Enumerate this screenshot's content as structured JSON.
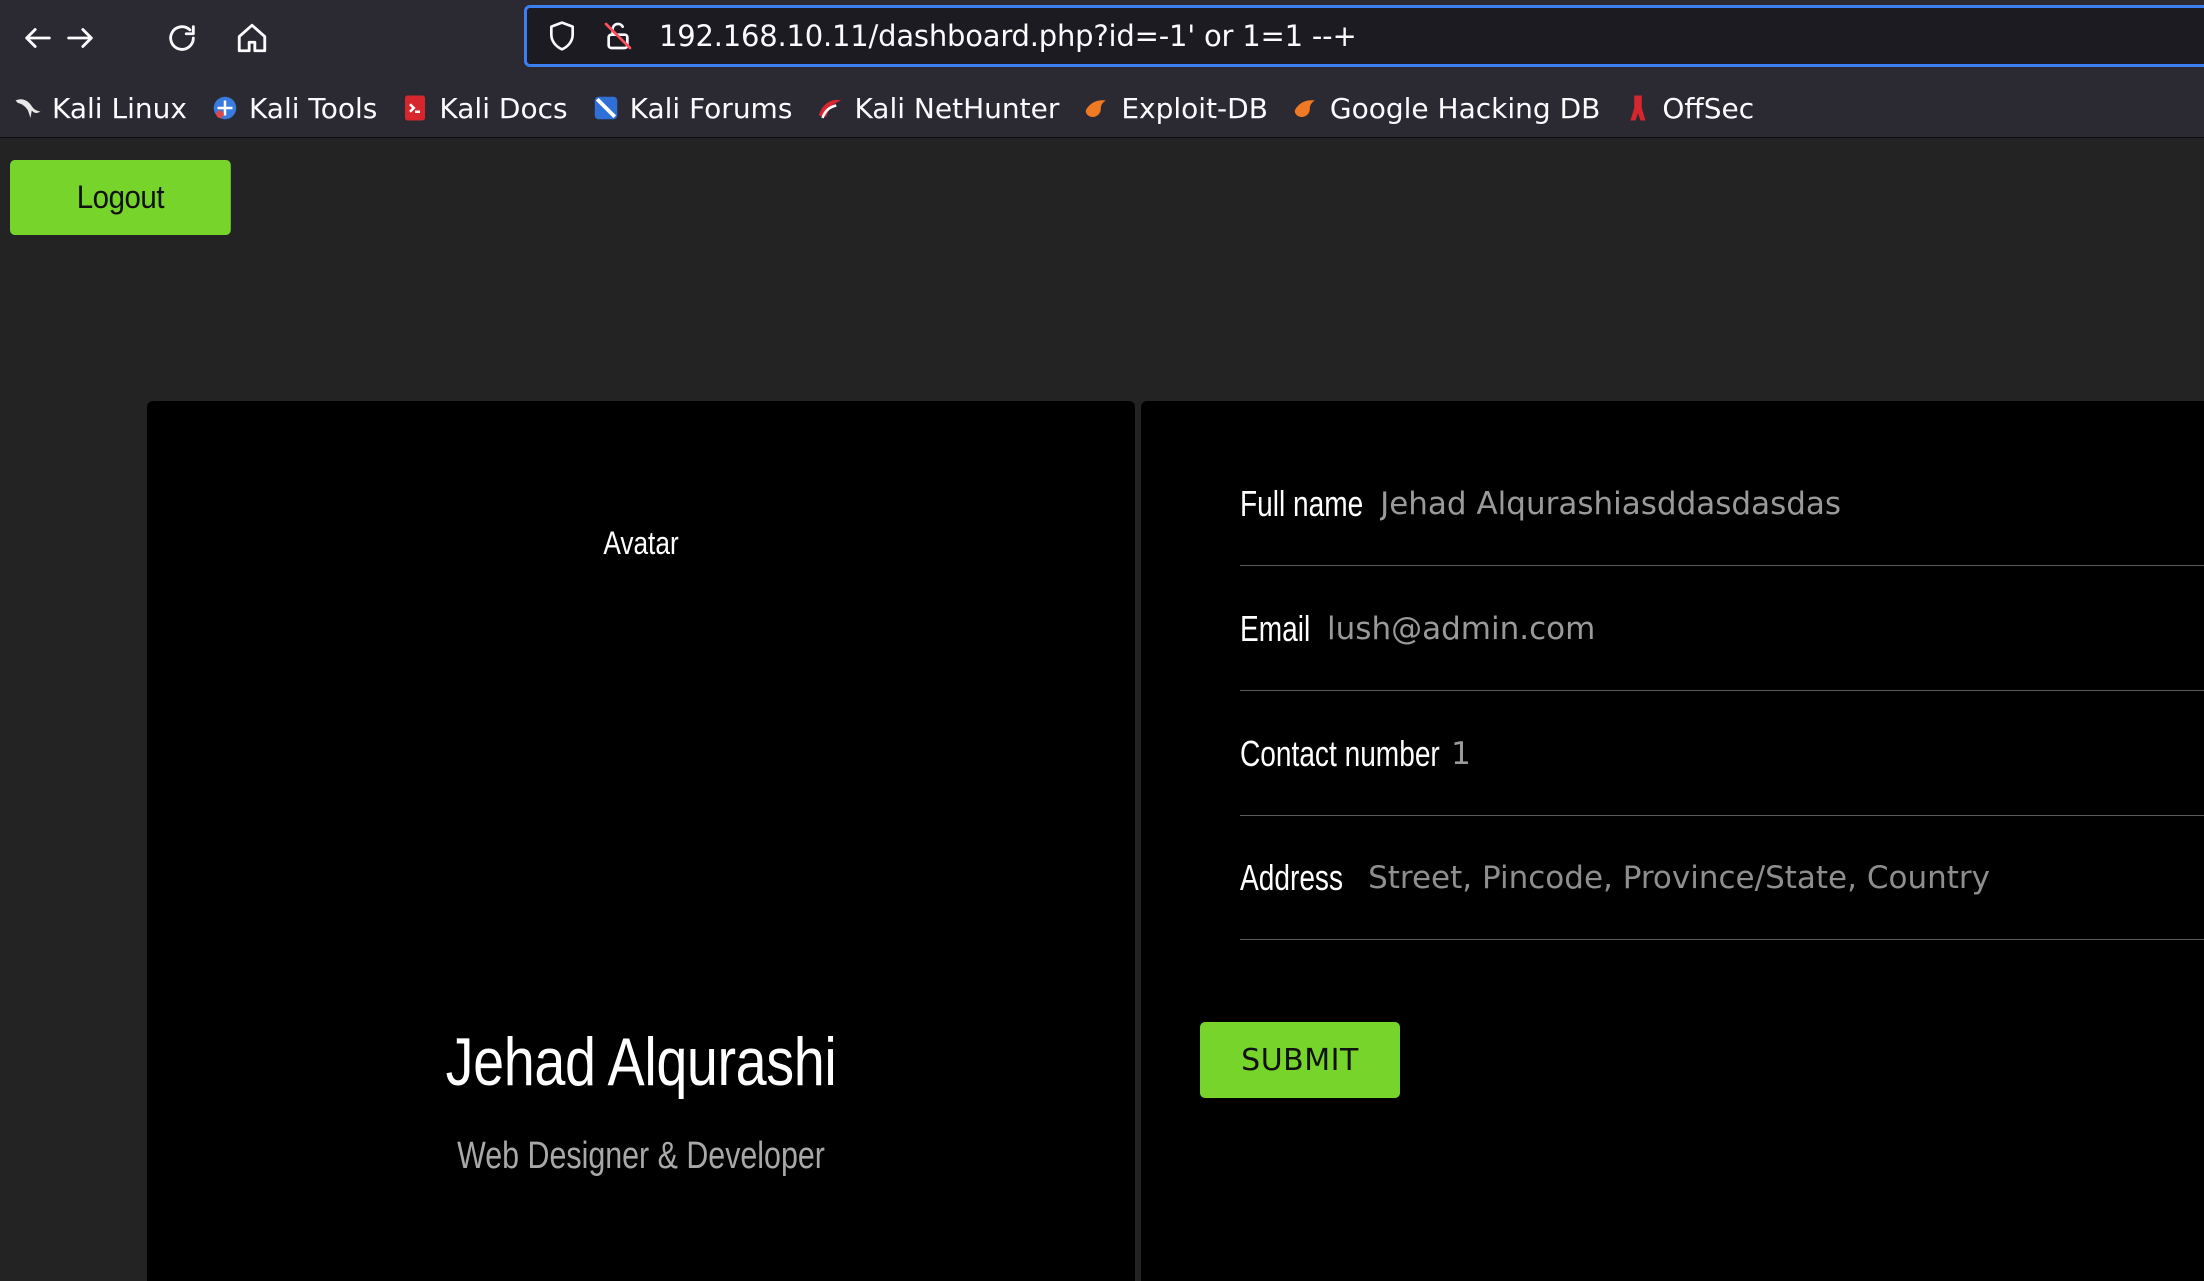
{
  "browser": {
    "url": "192.168.10.11/dashboard.php?id=-1' or 1=1 --+",
    "accent_color": "#3c7ff0",
    "bookmarks": [
      {
        "label": "Kali Linux",
        "icon": "kali-dragon-icon"
      },
      {
        "label": "Kali Tools",
        "icon": "kali-tools-icon"
      },
      {
        "label": "Kali Docs",
        "icon": "kali-docs-icon"
      },
      {
        "label": "Kali Forums",
        "icon": "kali-forums-icon"
      },
      {
        "label": "Kali NetHunter",
        "icon": "kali-nethunter-icon"
      },
      {
        "label": "Exploit-DB",
        "icon": "exploit-db-icon"
      },
      {
        "label": "Google Hacking DB",
        "icon": "google-hacking-db-icon"
      },
      {
        "label": "OffSec",
        "icon": "offsec-icon"
      }
    ]
  },
  "page": {
    "logout_label": "Logout",
    "button_color": "#76d42a",
    "profile": {
      "avatar_label": "Avatar",
      "name": "Jehad Alqurashi",
      "title": "Web Designer & Developer"
    },
    "form": {
      "fields": [
        {
          "label": "Full name",
          "value": "Jehad Alqurashiasddasdasdas",
          "placeholder": ""
        },
        {
          "label": "Email",
          "value": "lush@admin.com",
          "placeholder": ""
        },
        {
          "label": "Contact number",
          "value": "1",
          "placeholder": ""
        },
        {
          "label": "Address",
          "value": "",
          "placeholder": "Street, Pincode, Province/State, Country"
        }
      ],
      "submit_label": "SUBMIT"
    }
  }
}
